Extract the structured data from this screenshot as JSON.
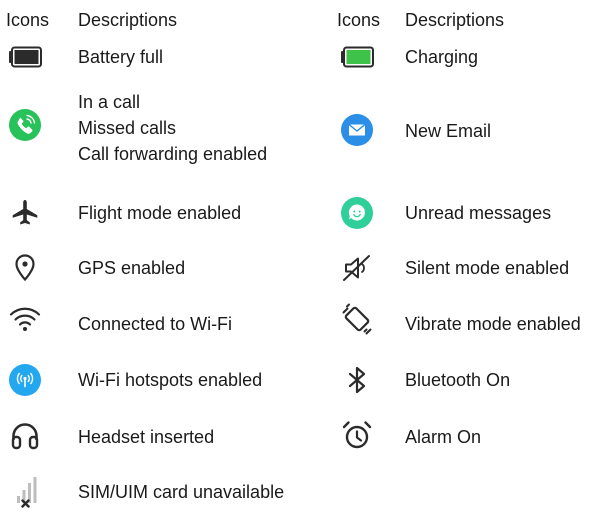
{
  "headers": {
    "icons_left": "Icons",
    "descriptions_left": "Descriptions",
    "icons_right": "Icons",
    "descriptions_right": "Descriptions"
  },
  "left_rows": [
    {
      "icon": "battery-full-icon",
      "description": "Battery full"
    },
    {
      "icon": "phone-call-icon",
      "description": "In a call\nMissed calls\nCall forwarding enabled"
    },
    {
      "icon": "airplane-icon",
      "description": "Flight mode enabled"
    },
    {
      "icon": "location-pin-icon",
      "description": "GPS enabled"
    },
    {
      "icon": "wifi-icon",
      "description": "Connected to Wi-Fi"
    },
    {
      "icon": "hotspot-icon",
      "description": "Wi-Fi hotspots enabled"
    },
    {
      "icon": "headset-icon",
      "description": "Headset inserted"
    },
    {
      "icon": "sim-unavailable-icon",
      "description": "SIM/UIM card unavailable"
    }
  ],
  "right_rows": [
    {
      "icon": "battery-charging-icon",
      "description": "Charging"
    },
    {
      "icon": "email-icon",
      "description": "New Email"
    },
    {
      "icon": "message-icon",
      "description": "Unread messages"
    },
    {
      "icon": "silent-mode-icon",
      "description": "Silent mode enabled"
    },
    {
      "icon": "vibrate-icon",
      "description": "Vibrate mode enabled"
    },
    {
      "icon": "bluetooth-icon",
      "description": "Bluetooth On"
    },
    {
      "icon": "alarm-icon",
      "description": "Alarm On"
    }
  ],
  "colors": {
    "call_green": "#27c25a",
    "charging_green": "#3ec24a",
    "email_blue": "#2b8fe8",
    "message_teal": "#2fcf9a",
    "hotspot_blue": "#23a8f0",
    "icon_dark": "#2b2b2b"
  }
}
